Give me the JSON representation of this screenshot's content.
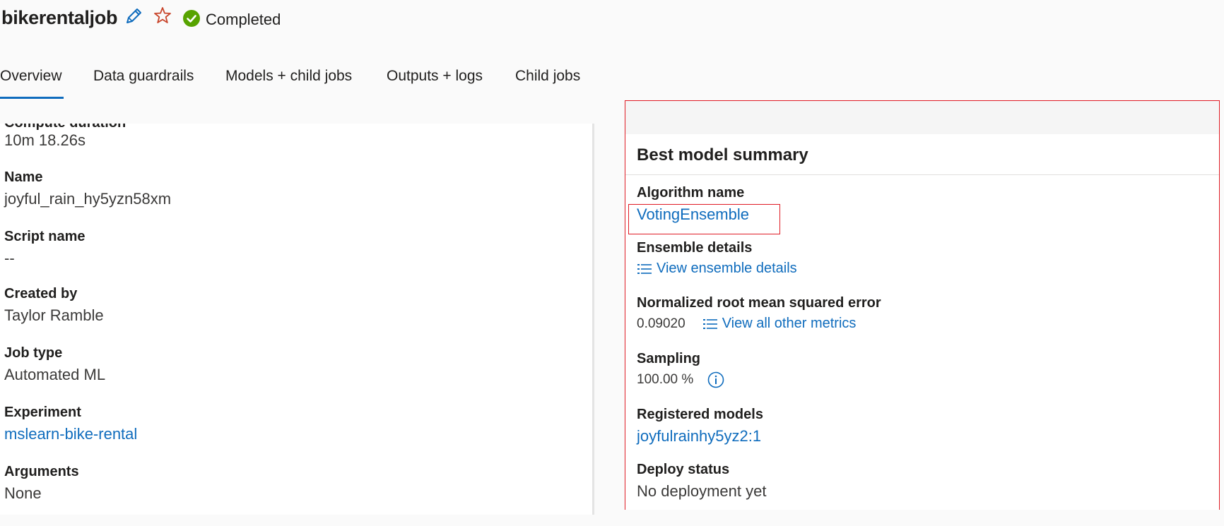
{
  "header": {
    "title": "bikerentaljob",
    "status": "Completed",
    "status_color": "#57a300"
  },
  "tabs": [
    {
      "label": "Overview",
      "active": true
    },
    {
      "label": "Data guardrails",
      "active": false
    },
    {
      "label": "Models + child jobs",
      "active": false
    },
    {
      "label": "Outputs + logs",
      "active": false
    },
    {
      "label": "Child jobs",
      "active": false
    }
  ],
  "details": {
    "compute_duration_label": "Compute duration",
    "compute_duration": "10m 18.26s",
    "name_label": "Name",
    "name": "joyful_rain_hy5yzn58xm",
    "script_name_label": "Script name",
    "script_name": "--",
    "created_by_label": "Created by",
    "created_by": "Taylor Ramble",
    "job_type_label": "Job type",
    "job_type": "Automated ML",
    "experiment_label": "Experiment",
    "experiment": "mslearn-bike-rental",
    "arguments_label": "Arguments",
    "arguments": "None"
  },
  "best_model": {
    "title": "Best model summary",
    "algorithm_label": "Algorithm name",
    "algorithm": "VotingEnsemble",
    "ensemble_label": "Ensemble details",
    "ensemble_link": "View ensemble details",
    "nrmse_label": "Normalized root mean squared error",
    "nrmse_value": "0.09020",
    "metrics_link": "View all other metrics",
    "sampling_label": "Sampling",
    "sampling_value": "100.00 %",
    "registered_label": "Registered models",
    "registered_value": "joyfulrainhy5yz2:1",
    "deploy_label": "Deploy status",
    "deploy_value": "No deployment yet"
  },
  "colors": {
    "link": "#0f6cbd",
    "highlight": "#e01b24",
    "star": "#c8452b"
  },
  "icons": [
    "edit-icon",
    "star-icon",
    "check-circle-icon",
    "list-icon",
    "info-icon"
  ]
}
